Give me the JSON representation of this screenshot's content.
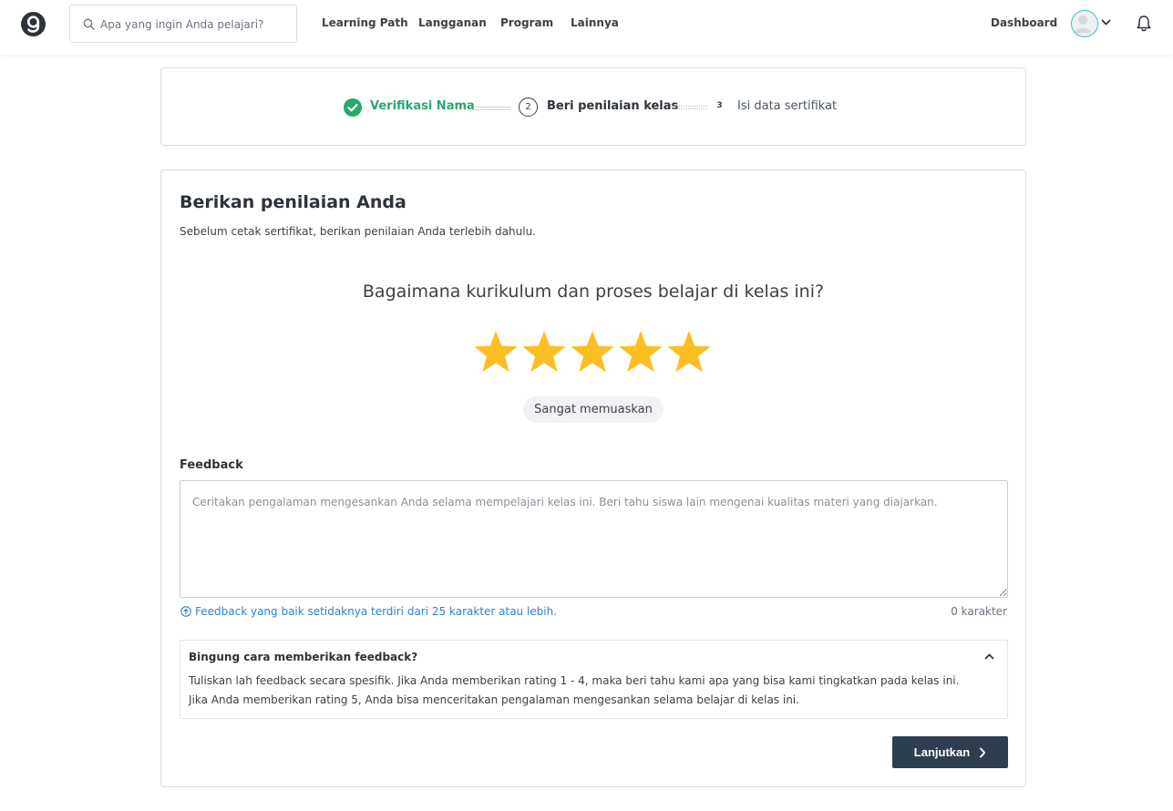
{
  "header": {
    "search_placeholder": "Apa yang ingin Anda pelajari?",
    "nav": [
      "Learning Path",
      "Langganan",
      "Program",
      "Lainnya"
    ],
    "dashboard_label": "Dashboard",
    "icons": {
      "logo": "dicoding-logo-icon",
      "search": "search-icon",
      "avatar": "user-avatar-icon",
      "dropdown": "chevron-down-icon",
      "bell": "notification-bell-icon"
    }
  },
  "stepper": {
    "steps": [
      {
        "number": "1",
        "label": "Verifikasi Nama",
        "status": "completed"
      },
      {
        "number": "2",
        "label": "Beri penilaian kelas",
        "status": "current"
      },
      {
        "number": "3",
        "label": "Isi data sertifikat",
        "status": "upcoming"
      }
    ]
  },
  "review": {
    "title": "Berikan penilaian Anda",
    "subtitle": "Sebelum cetak sertifikat, berikan penilaian Anda terlebih dahulu.",
    "question": "Bagaimana kurikulum dan proses belajar di kelas ini?",
    "rating": 5,
    "rating_max": 5,
    "rating_label": "Sangat memuaskan",
    "feedback_label": "Feedback",
    "feedback_value": "",
    "feedback_placeholder": "Ceritakan pengalaman mengesankan Anda selama mempelajari kelas ini. Beri tahu siswa lain mengenai kualitas materi yang diajarkan.",
    "hint": "Feedback yang baik setidaknya terdiri dari 25 karakter atau lebih.",
    "char_count": "0 karakter",
    "help": {
      "title": "Bingung cara memberikan feedback?",
      "line1": "Tuliskan lah feedback secara spesifik. Jika Anda memberikan rating 1 - 4, maka beri tahu kami apa yang bisa kami tingkatkan pada kelas ini.",
      "line2": "Jika Anda memberikan rating 5, Anda bisa menceritakan pengalaman mengesankan selama belajar di kelas ini."
    },
    "continue_label": "Lanjutkan"
  },
  "colors": {
    "success": "#28a86b",
    "star": "#fbbf24",
    "link": "#2f80d1",
    "button": "#2d3e50",
    "avatar_ring": "#3ec3c9"
  }
}
